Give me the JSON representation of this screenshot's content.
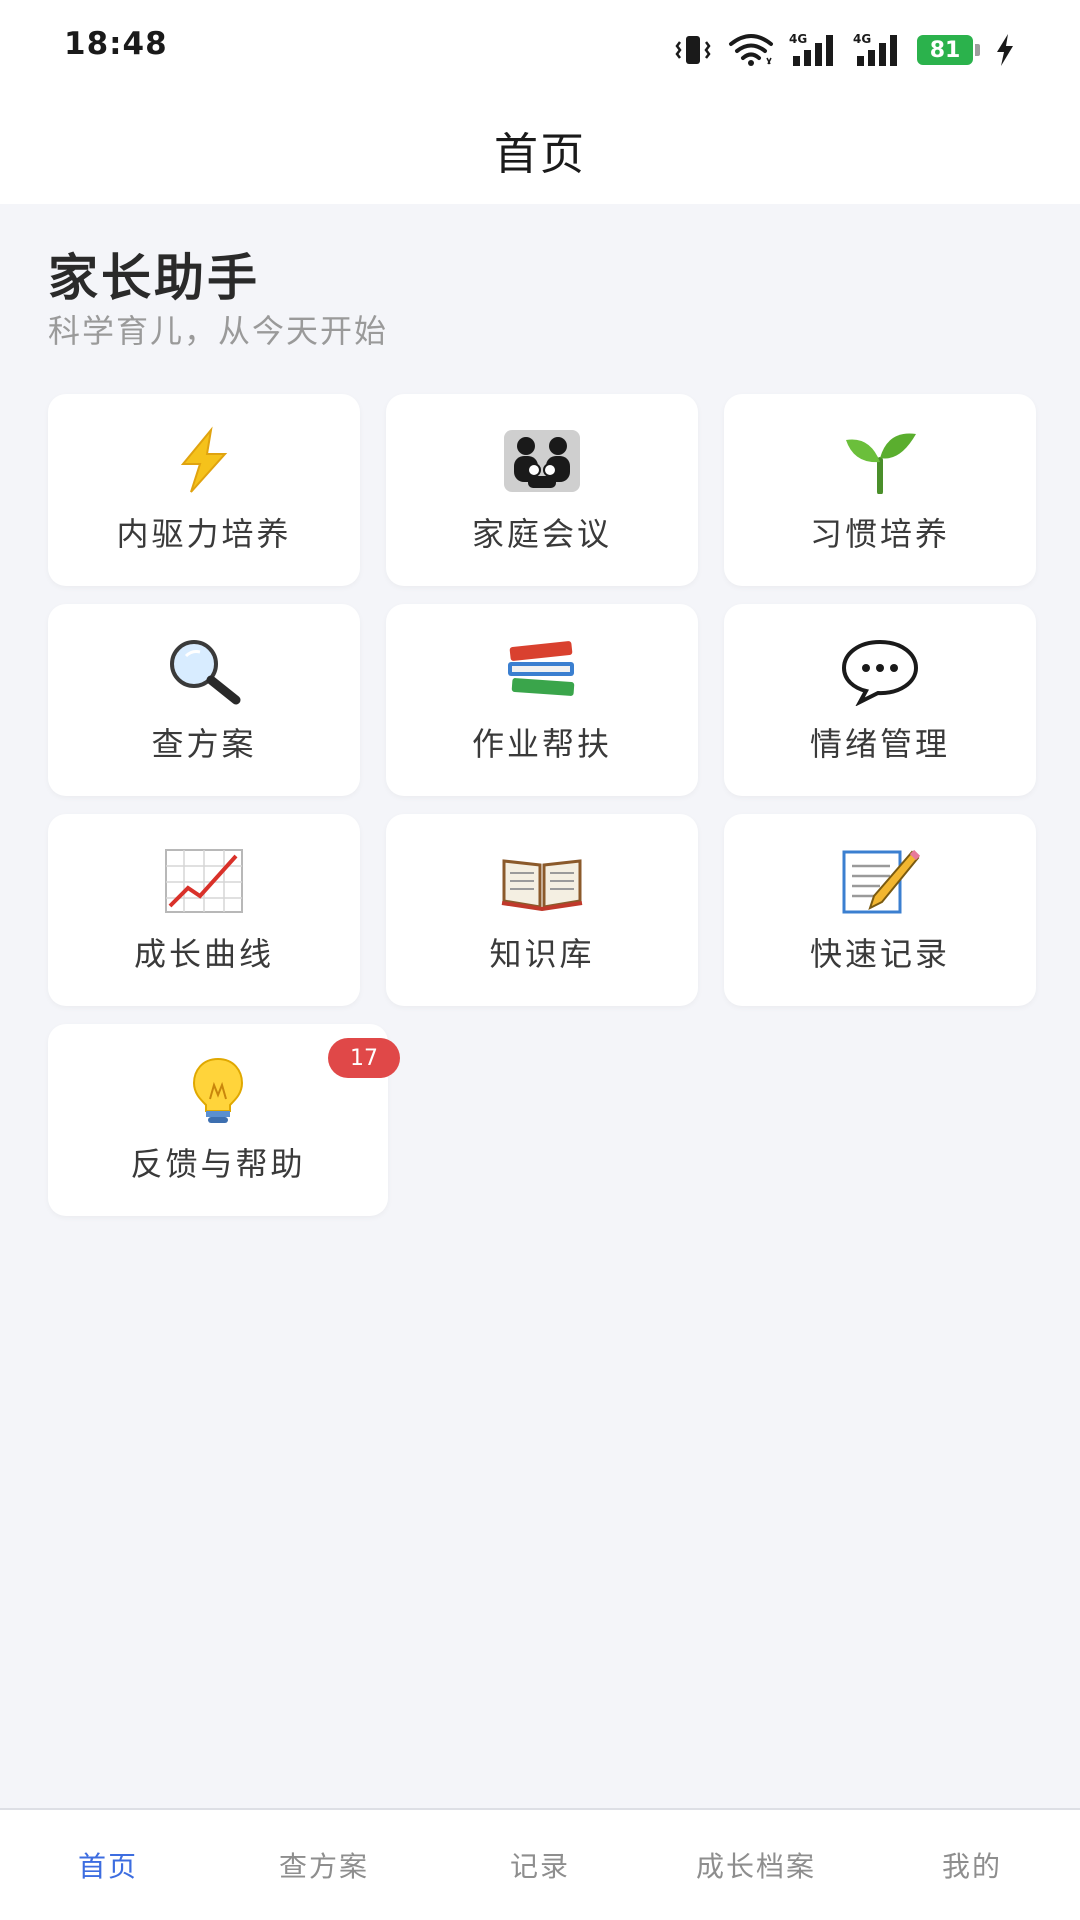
{
  "status_bar": {
    "time": "18:48",
    "network_1": "4G",
    "network_2": "4G",
    "battery": "81",
    "icons": [
      "vibrate-icon",
      "wifi-icon",
      "signal-icon",
      "signal-icon",
      "battery-icon",
      "charging-icon"
    ]
  },
  "title_bar": {
    "title": "首页"
  },
  "header": {
    "app_name": "家长助手",
    "subtitle": "科学育儿，从今天开始"
  },
  "tiles": [
    {
      "label": "内驱力培养",
      "icon": "lightning-icon"
    },
    {
      "label": "家庭会议",
      "icon": "family-icon"
    },
    {
      "label": "习惯培养",
      "icon": "seedling-icon"
    },
    {
      "label": "查方案",
      "icon": "magnifier-icon"
    },
    {
      "label": "作业帮扶",
      "icon": "books-icon"
    },
    {
      "label": "情绪管理",
      "icon": "speech-bubble-icon"
    },
    {
      "label": "成长曲线",
      "icon": "chart-up-icon"
    },
    {
      "label": "知识库",
      "icon": "open-book-icon"
    },
    {
      "label": "快速记录",
      "icon": "memo-icon"
    },
    {
      "label": "反馈与帮助",
      "icon": "lightbulb-icon",
      "badge": "17"
    }
  ],
  "bottom_nav": [
    {
      "label": "首页",
      "active": true
    },
    {
      "label": "查方案"
    },
    {
      "label": "记录"
    },
    {
      "label": "成长档案"
    },
    {
      "label": "我的"
    }
  ],
  "colors": {
    "accent": "#3d6de0",
    "background": "#f4f5f9",
    "badge": "#e04848",
    "battery": "#2bb24c"
  }
}
